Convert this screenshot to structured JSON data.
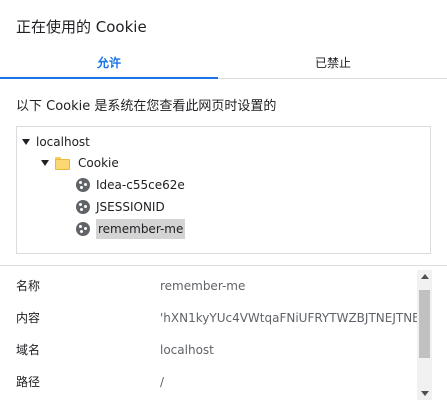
{
  "dialog": {
    "title": "正在使用的 Cookie"
  },
  "tabs": {
    "allowed": "允许",
    "blocked": "已禁止"
  },
  "description": "以下 Cookie 是系统在您查看此网页时设置的",
  "tree": {
    "site": "localhost",
    "folder": "Cookie",
    "cookies": [
      "Idea-c55ce62e",
      "JSESSIONID",
      "remember-me"
    ],
    "selected_index": 2
  },
  "details": [
    {
      "label": "名称",
      "value": "remember-me"
    },
    {
      "label": "内容",
      "value": "'hXN1kyYUc4VWtqaFNiUFRYTWZBJTNEJTNE"
    },
    {
      "label": "域名",
      "value": "localhost"
    },
    {
      "label": "路径",
      "value": "/"
    }
  ],
  "colors": {
    "accent": "#1a73e8",
    "selected_bg": "#d4d4d4",
    "folder": "#fbd872"
  },
  "icons": [
    "triangle-down-icon",
    "folder-icon",
    "cookie-icon",
    "scroll-up-icon",
    "scroll-down-icon"
  ]
}
